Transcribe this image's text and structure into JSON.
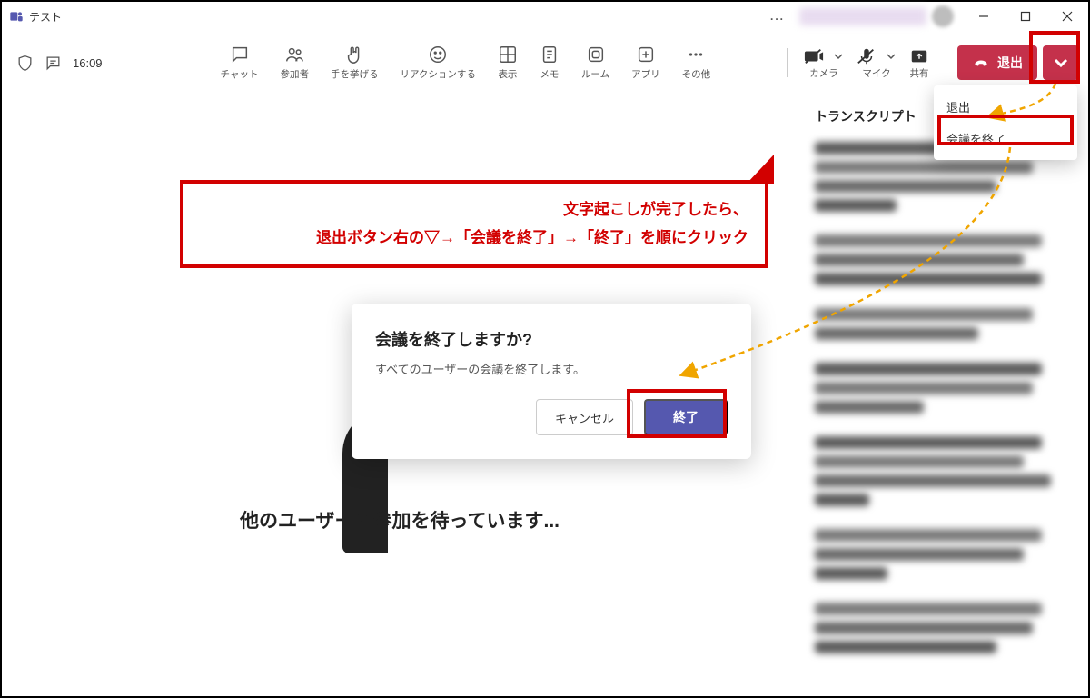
{
  "window": {
    "title": "テスト",
    "more": "...",
    "time": "16:09"
  },
  "toolbar": {
    "chat": "チャット",
    "participants": "参加者",
    "raise_hand": "手を挙げる",
    "reactions": "リアクションする",
    "view": "表示",
    "notes": "メモ",
    "room": "ルーム",
    "apps": "アプリ",
    "more": "その他",
    "camera": "カメラ",
    "mic": "マイク",
    "share": "共有",
    "leave": "退出"
  },
  "dropdown": {
    "leave": "退出",
    "end_meeting": "会議を終了"
  },
  "panel": {
    "title": "トランスクリプト"
  },
  "stage": {
    "waiting": "他のユーザーの参加を待っています..."
  },
  "dialog": {
    "title": "会議を終了しますか?",
    "message": "すべてのユーザーの会議を終了します。",
    "cancel": "キャンセル",
    "end": "終了"
  },
  "annotation": {
    "line1": "文字起こしが完了したら、",
    "line2": "退出ボタン右の▽→「会議を終了」→「終了」を順にクリック"
  }
}
